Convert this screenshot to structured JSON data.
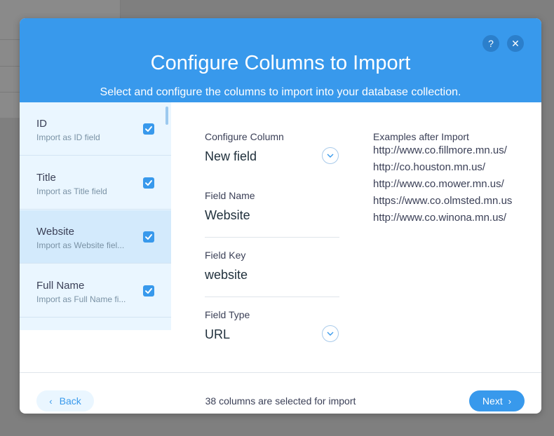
{
  "dialog": {
    "title": "Configure Columns to Import",
    "subtitle": "Select and configure the columns to import into your database collection.",
    "help_icon": "?",
    "close_icon": "✕"
  },
  "columns": [
    {
      "name": "ID",
      "hint": "Import as ID field",
      "checked": true,
      "selected": false
    },
    {
      "name": "Title",
      "hint": "Import as Title field",
      "checked": true,
      "selected": false
    },
    {
      "name": "Website",
      "hint": "Import as Website fiel...",
      "checked": true,
      "selected": true
    },
    {
      "name": "Full Name",
      "hint": "Import as Full Name fi...",
      "checked": true,
      "selected": false
    }
  ],
  "config": {
    "configure_column_label": "Configure Column",
    "configure_column_value": "New field",
    "field_name_label": "Field Name",
    "field_name_value": "Website",
    "field_key_label": "Field Key",
    "field_key_value": "website",
    "field_type_label": "Field Type",
    "field_type_value": "URL"
  },
  "examples": {
    "label": "Examples after Import",
    "items": [
      "http://www.co.fillmore.mn.us/",
      "http://co.houston.mn.us/",
      "http://www.co.mower.mn.us/",
      "https://www.co.olmsted.mn.us",
      "http://www.co.winona.mn.us/"
    ]
  },
  "footer": {
    "back_label": "Back",
    "back_icon": "‹",
    "next_label": "Next",
    "next_icon": "›",
    "status": "38 columns are selected for import"
  },
  "colors": {
    "accent": "#3899ec",
    "sidebar_bg": "#eaf6ff",
    "selected_bg": "#d3eafc"
  }
}
